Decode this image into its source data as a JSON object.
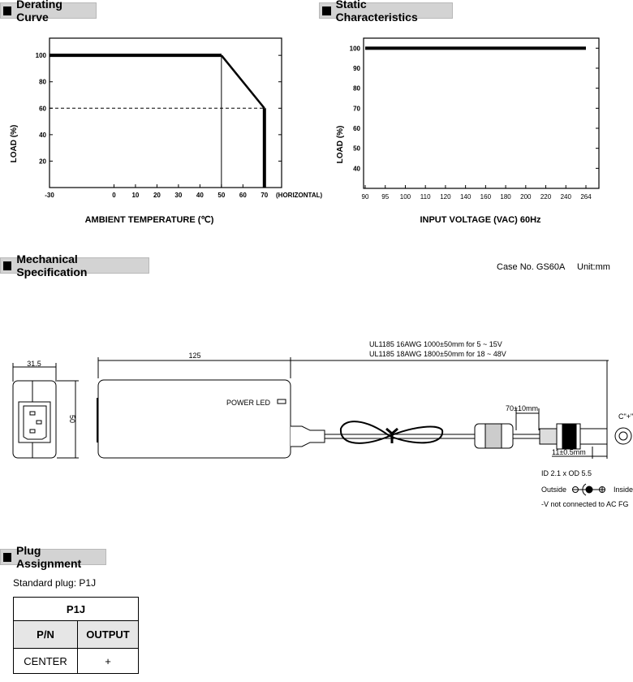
{
  "sections": {
    "derating": "Derating Curve",
    "static": "Static Characteristics",
    "mechanical": "Mechanical Specification",
    "plug": "Plug Assignment"
  },
  "chart_data": [
    {
      "type": "line",
      "xlabel": "AMBIENT TEMPERATURE (℃)",
      "ylabel": "LOAD (%)",
      "x_note": "(HORIZONTAL)",
      "xticks": [
        "-30",
        "0",
        "10",
        "20",
        "30",
        "40",
        "50",
        "60",
        "70"
      ],
      "yticks": [
        "20",
        "40",
        "60",
        "80",
        "100"
      ],
      "xlim": [
        -30,
        78
      ],
      "ylim": [
        0,
        113
      ],
      "series": [
        {
          "x": [
            -30,
            50,
            70,
            70
          ],
          "y": [
            100,
            100,
            60,
            0
          ]
        }
      ],
      "reference_lines": [
        {
          "type": "vertical",
          "x": 50,
          "y_from": 0,
          "y_to": 100
        },
        {
          "type": "horizontal-dashed",
          "y": 60,
          "x_from": -30,
          "x_to": 70
        }
      ],
      "grid": false
    },
    {
      "type": "line",
      "xlabel": "INPUT VOLTAGE (VAC) 60Hz",
      "ylabel": "LOAD (%)",
      "categories": [
        "90",
        "95",
        "100",
        "110",
        "120",
        "140",
        "160",
        "180",
        "200",
        "220",
        "240",
        "264"
      ],
      "yticks": [
        "40",
        "50",
        "60",
        "70",
        "80",
        "90",
        "100"
      ],
      "ylim": [
        30,
        105
      ],
      "series": [
        {
          "values": [
            100,
            100,
            100,
            100,
            100,
            100,
            100,
            100,
            100,
            100,
            100,
            100
          ]
        }
      ],
      "grid": false
    }
  ],
  "mechanical": {
    "case_no": "Case No. GS60A",
    "unit": "Unit:mm",
    "dim_width": "31.5",
    "dim_height": "50",
    "dim_length": "125",
    "power_led": "POWER LED",
    "cable_line1": "UL1185 16AWG 1000±50mm for 5 ~ 15V",
    "cable_line2": "UL1185 18AWG 1800±50mm for 18 ~ 48V",
    "ferrite_dist": "70±10mm",
    "plug_len": "11±0.5mm",
    "polarity_label": "C\"+\"",
    "plug_size": "ID 2.1 x OD 5.5",
    "outside": "Outside",
    "inside": "Inside",
    "note": "-V not connected to AC FG"
  },
  "plug": {
    "standard": "Standard plug: P1J",
    "table_title": "P1J",
    "headers": [
      "P/N",
      "OUTPUT"
    ],
    "rows": [
      [
        "CENTER",
        "+"
      ]
    ]
  }
}
